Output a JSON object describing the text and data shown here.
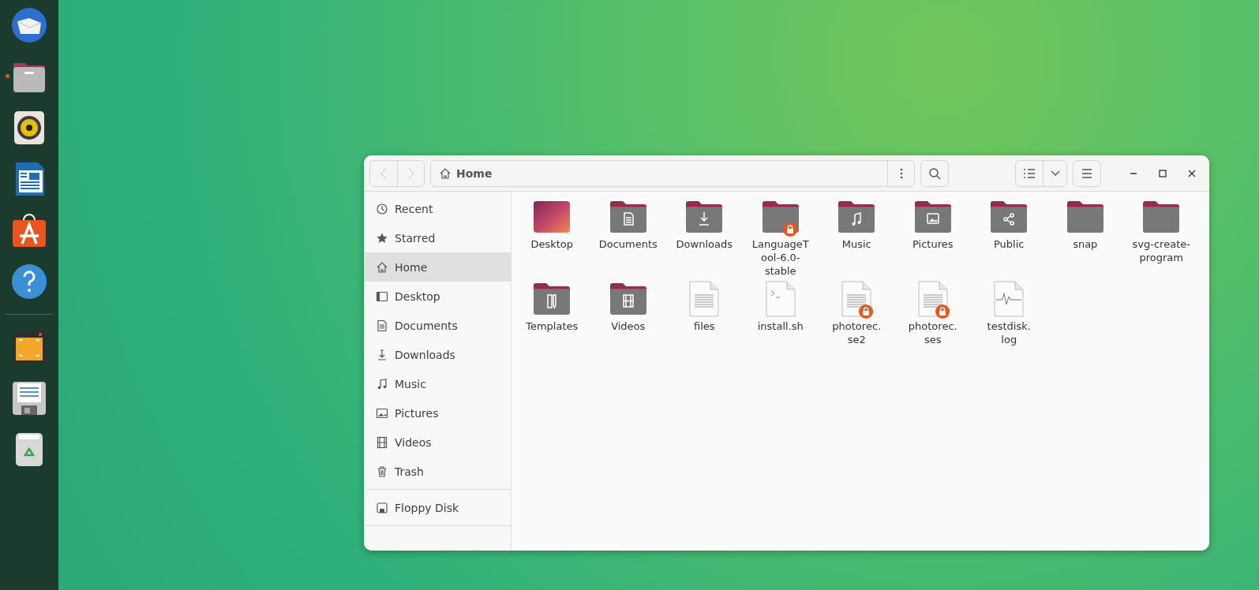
{
  "dock": [
    {
      "kind": "mail",
      "running": false
    },
    {
      "kind": "files",
      "running": true
    },
    {
      "kind": "speaker",
      "running": false
    },
    {
      "kind": "writer",
      "running": false
    },
    {
      "kind": "store",
      "running": false
    },
    {
      "kind": "help",
      "running": false
    },
    {
      "kind": "separator"
    },
    {
      "kind": "screenshot",
      "running": false
    },
    {
      "kind": "floppy",
      "running": false
    },
    {
      "kind": "trash",
      "running": false
    }
  ],
  "window": {
    "path": "Home"
  },
  "sidebar": {
    "places": [
      {
        "label": "Recent",
        "kind": "recent",
        "selected": false
      },
      {
        "label": "Starred",
        "kind": "star",
        "selected": false
      },
      {
        "label": "Home",
        "kind": "home",
        "selected": true
      },
      {
        "label": "Desktop",
        "kind": "desktop",
        "selected": false
      },
      {
        "label": "Documents",
        "kind": "documents",
        "selected": false
      },
      {
        "label": "Downloads",
        "kind": "downloads",
        "selected": false
      },
      {
        "label": "Music",
        "kind": "music",
        "selected": false
      },
      {
        "label": "Pictures",
        "kind": "pictures",
        "selected": false
      },
      {
        "label": "Videos",
        "kind": "videos",
        "selected": false
      },
      {
        "label": "Trash",
        "kind": "trash",
        "selected": false
      }
    ],
    "devices": [
      {
        "label": "Floppy Disk",
        "kind": "floppy",
        "selected": false
      }
    ]
  },
  "files": [
    {
      "name": "Desktop",
      "kind": "desktop",
      "locked": false
    },
    {
      "name": "Documents",
      "kind": "documents",
      "locked": false
    },
    {
      "name": "Downloads",
      "kind": "downloads",
      "locked": false
    },
    {
      "name": "LanguageT ool-6.0- stable",
      "kind": "folder",
      "locked": true
    },
    {
      "name": "Music",
      "kind": "music",
      "locked": false
    },
    {
      "name": "Pictures",
      "kind": "pictures",
      "locked": false
    },
    {
      "name": "Public",
      "kind": "public",
      "locked": false
    },
    {
      "name": "snap",
      "kind": "folder",
      "locked": false
    },
    {
      "name": "svg-create- program",
      "kind": "folder",
      "locked": false
    },
    {
      "name": "Templates",
      "kind": "templates",
      "locked": false
    },
    {
      "name": "Videos",
      "kind": "videos",
      "locked": false
    },
    {
      "name": "files",
      "kind": "text",
      "locked": false
    },
    {
      "name": "install.sh",
      "kind": "script",
      "locked": false
    },
    {
      "name": "photorec. se2",
      "kind": "text",
      "locked": true
    },
    {
      "name": "photorec. ses",
      "kind": "text",
      "locked": true
    },
    {
      "name": "testdisk. log",
      "kind": "log",
      "locked": false
    }
  ]
}
